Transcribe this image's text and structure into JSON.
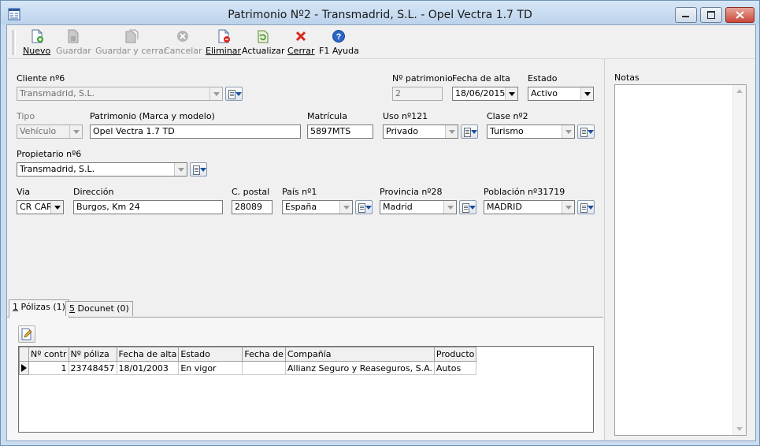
{
  "window": {
    "title": "Patrimonio Nº2 - Transmadrid, S.L. - Opel Vectra 1.7 TD"
  },
  "toolbar": {
    "nuevo": "Nuevo",
    "guardar": "Guardar",
    "guardar_cerrar": "Guardar y cerrar",
    "cancelar": "Cancelar",
    "eliminar": "Eliminar",
    "actualizar": "Actualizar",
    "cerrar": "Cerrar",
    "ayuda": "F1 Ayuda"
  },
  "form": {
    "cliente": {
      "label": "Cliente nº6",
      "value": "Transmadrid, S.L."
    },
    "n_patrimonio": {
      "label": "Nº patrimonio",
      "value": "2"
    },
    "fecha_alta": {
      "label": "Fecha de alta",
      "value": "18/06/2015"
    },
    "estado": {
      "label": "Estado",
      "value": "Activo"
    },
    "tipo": {
      "label": "Tipo",
      "value": "Vehículo"
    },
    "patrimonio": {
      "label": "Patrimonio (Marca y modelo)",
      "value": "Opel Vectra 1.7 TD"
    },
    "matricula": {
      "label": "Matrícula",
      "value": "5897MTS"
    },
    "uso": {
      "label": "Uso nº121",
      "value": "Privado"
    },
    "clase": {
      "label": "Clase nº2",
      "value": "Turismo"
    },
    "propietario": {
      "label": "Propietario nº6",
      "value": "Transmadrid, S.L."
    },
    "via": {
      "label": "Via",
      "value": "CR CAR"
    },
    "direccion": {
      "label": "Dirección",
      "value": "Burgos, Km 24"
    },
    "cpostal": {
      "label": "C. postal",
      "value": "28089"
    },
    "pais": {
      "label": "País nº1",
      "value": "España"
    },
    "provincia": {
      "label": "Provincia nº28",
      "value": "Madrid"
    },
    "poblacion": {
      "label": "Población nº31719",
      "value": "MADRID"
    }
  },
  "notes": {
    "label": "Notas"
  },
  "tabs": [
    {
      "key": "1",
      "label": " Pólizas (1)"
    },
    {
      "key": "5",
      "label": " Docunet (0)"
    }
  ],
  "grid": {
    "columns": [
      "Nº contr",
      "Nº póliza",
      "Fecha de alta",
      "Estado",
      "Fecha de",
      "Compañía",
      "Producto"
    ],
    "rows": [
      {
        "n_contr": "1",
        "n_poliza": "23748457",
        "fecha_alta": "18/01/2003",
        "estado": "En vigor",
        "fecha_de": "",
        "compania": "Allianz Seguro y Reaseguros, S.A.",
        "producto": "Autos"
      }
    ]
  },
  "colors": {
    "title_bar": "#bcd3ec",
    "close_button": "#c9473a",
    "delete_icon": "#d9261c",
    "help_icon": "#2a66c8"
  }
}
